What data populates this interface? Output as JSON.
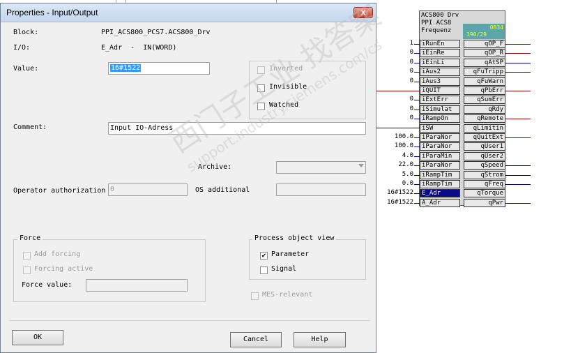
{
  "dialog": {
    "title": "Properties - Input/Output",
    "close_label": "X",
    "block_label": "Block:",
    "block_value": "PPI_ACS800_PCS7.ACS800_Drv",
    "io_label": "I/O:",
    "io_value": "E_Adr  -  IN(WORD)",
    "value_label": "Value:",
    "value_value": "16#1522",
    "comment_label": "Comment:",
    "comment_value": "Input IO-Adress",
    "archive_label": "Archive:",
    "operator_label": "Operator authorization",
    "operator_value": "0",
    "os_label": "OS additional",
    "options": {
      "inverted": {
        "label": "Inverted",
        "checked": false,
        "enabled": false
      },
      "invisible": {
        "label": "Invisible",
        "checked": false,
        "enabled": true
      },
      "watched": {
        "label": "Watched",
        "checked": false,
        "enabled": true
      }
    },
    "force": {
      "title": "Force",
      "add_forcing": "Add forcing",
      "forcing_active": "Forcing active",
      "force_value_label": "Force value:"
    },
    "process_view": {
      "title": "Process object view",
      "parameter": "Parameter",
      "parameter_checked": true,
      "signal": "Signal",
      "signal_checked": false
    },
    "mes_relevant": "MES-relevant",
    "ok_label": "OK",
    "cancel_label": "Cancel",
    "help_label": "Help"
  },
  "watermark": {
    "line1": "西门子工业  找答案",
    "line2": "support.industry.siemens.com/cs"
  },
  "block": {
    "header": [
      "ACS800 Drv",
      "PPI ACS8",
      "Frequenz"
    ],
    "teal_top": "OB34",
    "teal_bottom": "390/29",
    "inputs": [
      {
        "value": "1",
        "name": "iRunEn"
      },
      {
        "value": "0",
        "name": "iEinRe"
      },
      {
        "value": "0",
        "name": "iEinLi"
      },
      {
        "value": "0",
        "name": "iAus2"
      },
      {
        "value": "0",
        "name": "iAus3"
      },
      {
        "value": "",
        "name": "iQUIT"
      },
      {
        "value": "0",
        "name": "iExtErr"
      },
      {
        "value": "0",
        "name": "iSimulat"
      },
      {
        "value": "0",
        "name": "iRampOn"
      },
      {
        "value": "",
        "name": "iSW"
      },
      {
        "value": "100.0",
        "name": "iParaNor"
      },
      {
        "value": "100.0",
        "name": "iParaNor"
      },
      {
        "value": "4.0",
        "name": "iParaMin"
      },
      {
        "value": "22.0",
        "name": "iParaNor"
      },
      {
        "value": "5.0",
        "name": "iRampTim"
      },
      {
        "value": "0.0",
        "name": "iRampTim"
      },
      {
        "value": "16#1522",
        "name": "E_Adr"
      },
      {
        "value": "16#1522",
        "name": "A_Adr"
      }
    ],
    "outputs": [
      "qOP_F",
      "qOP_R",
      "qAtSP",
      "qFuTripp",
      "qFuWarn",
      "qPbErr",
      "qSumErr",
      "qRdy",
      "qRemote",
      "qLimitin",
      "qQuitExt",
      "qUser1",
      "qUser2",
      "qSpeed",
      "qStrom",
      "qFreq",
      "qTorque",
      "qPwr"
    ]
  }
}
